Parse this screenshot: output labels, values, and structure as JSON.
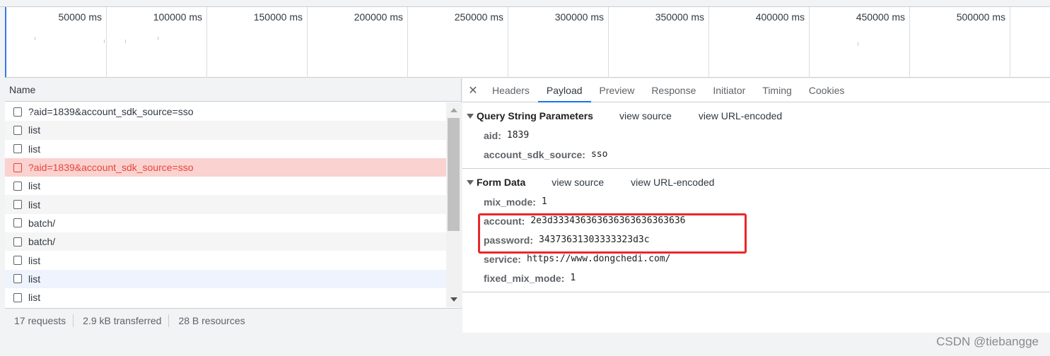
{
  "timeline": {
    "ticks": [
      "50000 ms",
      "100000 ms",
      "150000 ms",
      "200000 ms",
      "250000 ms",
      "300000 ms",
      "350000 ms",
      "400000 ms",
      "450000 ms",
      "500000 ms"
    ]
  },
  "requests": {
    "column_header": "Name",
    "rows": [
      {
        "name": "?aid=1839&account_sdk_source=sso",
        "state": "normal"
      },
      {
        "name": "list",
        "state": "normal"
      },
      {
        "name": "list",
        "state": "normal"
      },
      {
        "name": "?aid=1839&account_sdk_source=sso",
        "state": "selected"
      },
      {
        "name": "list",
        "state": "normal"
      },
      {
        "name": "list",
        "state": "normal"
      },
      {
        "name": "batch/",
        "state": "normal"
      },
      {
        "name": "batch/",
        "state": "normal"
      },
      {
        "name": "list",
        "state": "normal"
      },
      {
        "name": "list",
        "state": "hover"
      },
      {
        "name": "list",
        "state": "normal"
      }
    ],
    "summary": {
      "requests": "17 requests",
      "transferred": "2.9 kB transferred",
      "resources": "28 B resources"
    }
  },
  "detail": {
    "close_icon": "close-icon",
    "tabs": [
      "Headers",
      "Payload",
      "Preview",
      "Response",
      "Initiator",
      "Timing",
      "Cookies"
    ],
    "active_tab": "Payload",
    "query_section": {
      "title": "Query String Parameters",
      "view_source": "view source",
      "view_encoded": "view URL-encoded",
      "params": [
        {
          "key": "aid:",
          "value": "1839"
        },
        {
          "key": "account_sdk_source:",
          "value": "sso"
        }
      ]
    },
    "form_section": {
      "title": "Form Data",
      "view_source": "view source",
      "view_encoded": "view URL-encoded",
      "params": [
        {
          "key": "mix_mode:",
          "value": "1"
        },
        {
          "key": "account:",
          "value": "2e3d333436363636363636363636"
        },
        {
          "key": "password:",
          "value": "34373631303333323d3c"
        },
        {
          "key": "service:",
          "value": "https://www.dongchedi.com/"
        },
        {
          "key": "fixed_mix_mode:",
          "value": "1"
        }
      ]
    }
  },
  "watermark": "CSDN @tiebangge",
  "colors": {
    "selected_row_bg": "#fad2cf",
    "selected_row_text": "#e8453c",
    "active_tab_underline": "#1a73e8",
    "annotation_box": "#e8282a"
  }
}
